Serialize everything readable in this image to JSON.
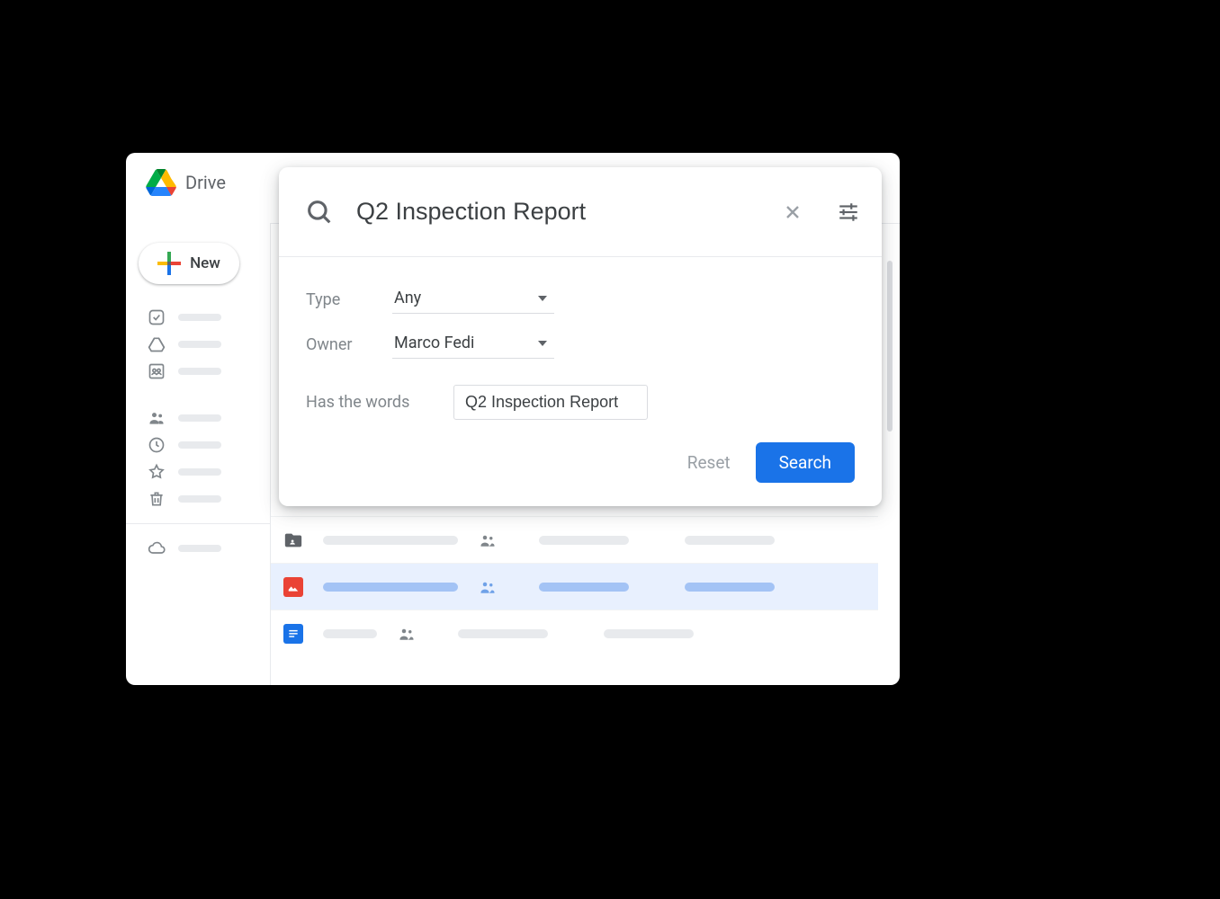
{
  "brand": {
    "name": "Drive"
  },
  "new_button": {
    "label": "New"
  },
  "search": {
    "query": "Q2 Inspection Report",
    "filters": {
      "type_label": "Type",
      "type_value": "Any",
      "owner_label": "Owner",
      "owner_value": "Marco Fedi",
      "words_label": "Has the words",
      "words_value": "Q2 Inspection Report"
    },
    "actions": {
      "reset_label": "Reset",
      "search_label": "Search"
    }
  }
}
